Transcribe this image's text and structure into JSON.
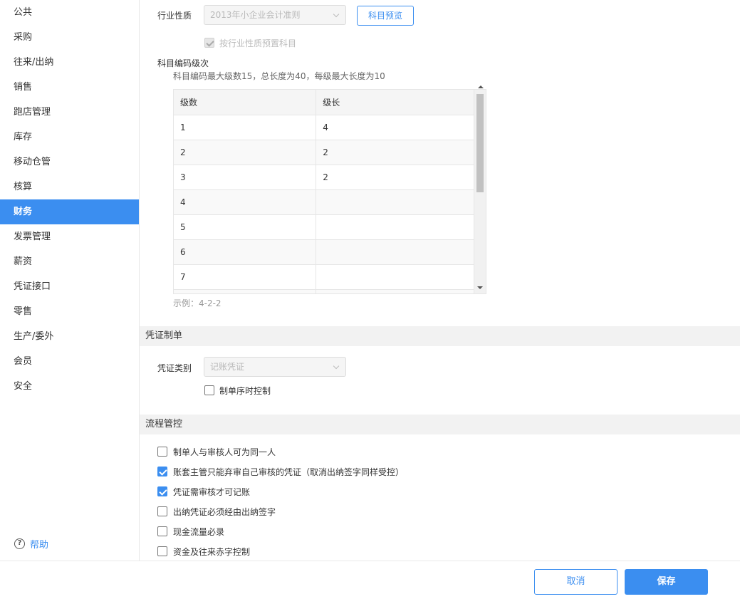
{
  "sidebar": {
    "items": [
      {
        "label": "公共"
      },
      {
        "label": "采购"
      },
      {
        "label": "往来/出纳"
      },
      {
        "label": "销售"
      },
      {
        "label": "跑店管理"
      },
      {
        "label": "库存"
      },
      {
        "label": "移动仓管"
      },
      {
        "label": "核算"
      },
      {
        "label": "财务",
        "active": true
      },
      {
        "label": "发票管理"
      },
      {
        "label": "薪资"
      },
      {
        "label": "凭证接口"
      },
      {
        "label": "零售"
      },
      {
        "label": "生产/委外"
      },
      {
        "label": "会员"
      },
      {
        "label": "安全"
      }
    ],
    "help_label": "帮助",
    "active_color": "#3b8ef0"
  },
  "industry": {
    "label": "行业性质",
    "value": "2013年小企业会计准则",
    "preview_button": "科目预览",
    "preset_checkbox": "按行业性质预置科目"
  },
  "coding": {
    "title": "科目编码级次",
    "hint": "科目编码最大级数15，总长度为40，每级最大长度为10",
    "table": {
      "headers": [
        "级数",
        "级长"
      ],
      "rows": [
        [
          "1",
          "4"
        ],
        [
          "2",
          "2"
        ],
        [
          "3",
          "2"
        ],
        [
          "4",
          ""
        ],
        [
          "5",
          ""
        ],
        [
          "6",
          ""
        ],
        [
          "7",
          ""
        ]
      ]
    },
    "example": "示例：4-2-2"
  },
  "voucher": {
    "section_title": "凭证制单",
    "type_label": "凭证类别",
    "type_value": "记账凭证",
    "time_control": "制单序时控制"
  },
  "process": {
    "section_title": "流程管控",
    "options": [
      {
        "label": "制单人与审核人可为同一人",
        "checked": false
      },
      {
        "label": "账套主管只能弃审自己审核的凭证（取消出纳签字同样受控）",
        "checked": true
      },
      {
        "label": "凭证需审核才可记账",
        "checked": true
      },
      {
        "label": "出纳凭证必须经由出纳签字",
        "checked": false
      },
      {
        "label": "现金流量必录",
        "checked": false
      },
      {
        "label": "资金及往来赤字控制",
        "checked": false
      }
    ]
  },
  "footer": {
    "cancel": "取消",
    "save": "保存"
  }
}
